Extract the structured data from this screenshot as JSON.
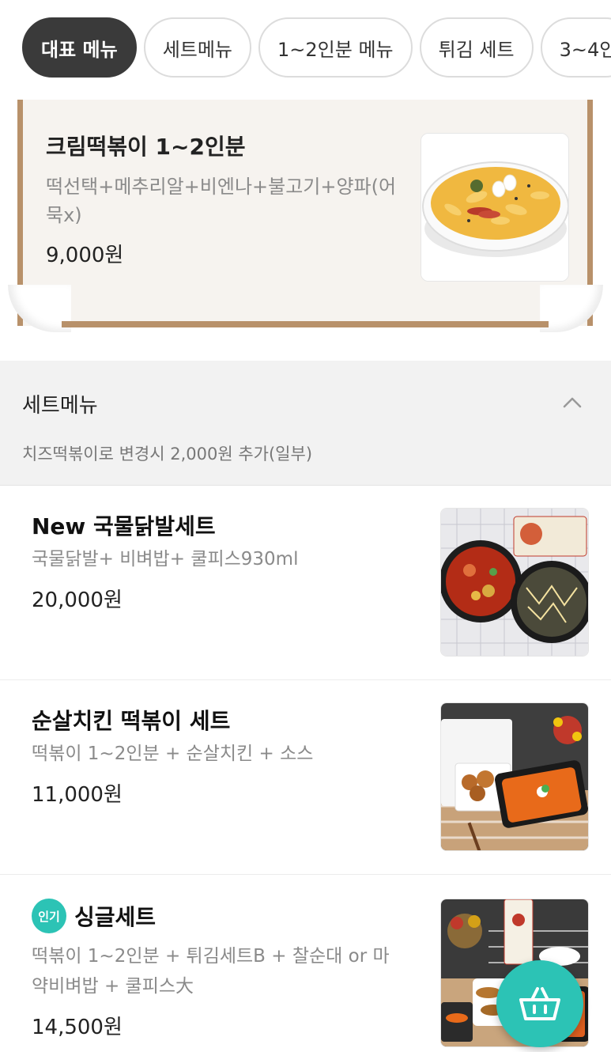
{
  "tabs": [
    {
      "label": "대표 메뉴",
      "active": true
    },
    {
      "label": "세트메뉴"
    },
    {
      "label": "1~2인분 메뉴"
    },
    {
      "label": "튀김 세트"
    },
    {
      "label": "3~4인"
    }
  ],
  "featured": {
    "title": "크림떡볶이 1~2인분",
    "desc": "떡선택+메추리알+비엔나+불고기+양파(어묵x)",
    "price": "9,000원"
  },
  "section": {
    "title": "세트메뉴",
    "note": "치즈떡볶이로 변경시 2,000원 추가(일부)",
    "chevron_icon": "chevron-up-icon"
  },
  "items": [
    {
      "title": "New 국물닭발세트",
      "desc": "국물닭발+ 비벼밥+ 쿨피스930ml",
      "price": "20,000원"
    },
    {
      "title": "순살치킨 떡볶이 세트",
      "desc": "떡볶이 1~2인분 + 순살치킨 + 소스",
      "price": "11,000원"
    },
    {
      "title": "싱글세트",
      "desc": "떡볶이 1~2인분 + 튀김세트B + 찰순대 or 마약비벼밥 + 쿨피스大",
      "price": "14,500원",
      "badge": "인기"
    }
  ],
  "fab": {
    "icon": "basket-icon"
  },
  "colors": {
    "accent": "#2cc3b5",
    "active_tab": "#3a3a3a",
    "scroll_border": "#b8916a"
  }
}
